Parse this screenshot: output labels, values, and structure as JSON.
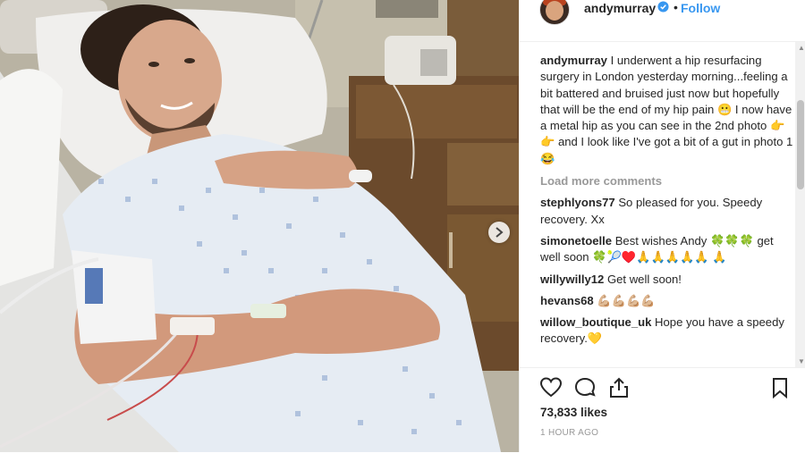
{
  "post": {
    "username": "andymurray",
    "follow_label": "Follow",
    "dot": "•",
    "caption_user": "andymurray",
    "caption_text": "I underwent a hip resurfacing surgery in London yesterday morning...feeling a bit battered and bruised just now but hopefully that will be the end of my hip pain 😬 I now have a metal hip as you can see in the 2nd photo 👉👉 and I look like I've got a bit of a gut in photo 1 😂",
    "load_more": "Load more comments",
    "comments": [
      {
        "user": "stephlyons77",
        "text": "So pleased for you. Speedy recovery. Xx"
      },
      {
        "user": "simonetoelle",
        "text": "Best wishes Andy 🍀🍀🍀 get well soon 🍀🎾♥️🙏🙏🙏🙏🙏 🙏"
      },
      {
        "user": "willywilly12",
        "text": "Get well soon!"
      },
      {
        "user": "hevans68",
        "text": "💪🏼💪🏼💪🏼💪🏼"
      },
      {
        "user": "willow_boutique_uk",
        "text": "Hope you have a speedy recovery.💛"
      }
    ],
    "likes": "73,833 likes",
    "time": "1 HOUR AGO"
  },
  "icons": {
    "verified": "verified-badge-icon",
    "like": "heart-icon",
    "comment": "comment-bubble-icon",
    "share": "share-icon",
    "save": "bookmark-icon",
    "next": "chevron-right-icon"
  },
  "colors": {
    "link": "#3897f0",
    "text": "#262626",
    "muted": "#999999",
    "border": "#efefef"
  }
}
